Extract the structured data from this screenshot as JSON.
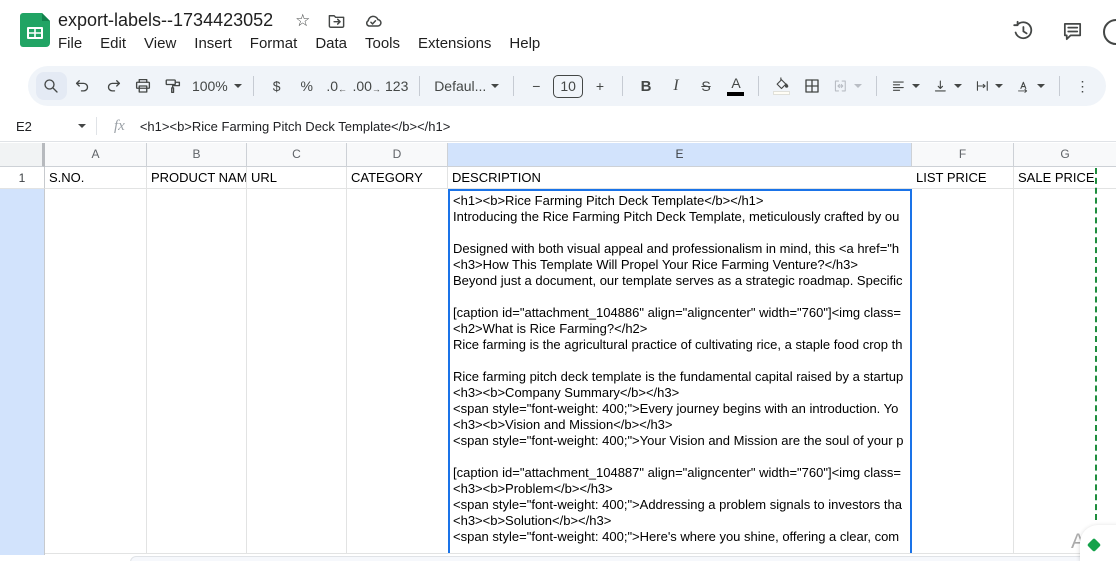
{
  "colors": {
    "logo_green": "#21a464",
    "selection_blue": "#1a73e8",
    "selected_header_bg": "#d2e3fc",
    "dashed_green": "#1e8e3e",
    "toolbar_bg": "#f0f4f9"
  },
  "header": {
    "title": "export-labels--1734423052",
    "menu": [
      "File",
      "Edit",
      "View",
      "Insert",
      "Format",
      "Data",
      "Tools",
      "Extensions",
      "Help"
    ]
  },
  "toolbar": {
    "zoom": "100%",
    "currency": "$",
    "percent": "%",
    "decimal_decrease": ".0",
    "decimal_increase": ".00",
    "number_format": "123",
    "font_family": "Defaul...",
    "minus": "−",
    "font_size": "10",
    "plus": "+",
    "bold": "B",
    "italic": "I",
    "strikethrough": "S",
    "text_color": "A",
    "more": "⋮"
  },
  "formula_bar": {
    "cell_reference": "E2",
    "fx": "fx",
    "formula": "<h1><b>Rice Farming Pitch Deck Template</b></h1>"
  },
  "grid": {
    "columns": [
      "A",
      "B",
      "C",
      "D",
      "E",
      "F",
      "G"
    ],
    "selected_column": "E",
    "row_numbers": [
      "1"
    ],
    "header_row": [
      "S.NO.",
      "PRODUCT NAM",
      "URL",
      "CATEGORY",
      "DESCRIPTION",
      "LIST PRICE",
      "SALE PRICE"
    ],
    "e2_lines": [
      "<h1><b>Rice Farming Pitch Deck Template</b></h1>",
      "Introducing the Rice Farming Pitch Deck Template, meticulously crafted by ou",
      "",
      "Designed with both visual appeal and professionalism in mind, this <a href=\"h",
      "<h3>How This Template Will Propel Your Rice Farming Venture?</h3>",
      "Beyond just a document, our template serves as a strategic roadmap. Specific",
      "",
      "[caption id=\"attachment_104886\" align=\"aligncenter\" width=\"760\"]<img class=",
      "<h2>What is Rice Farming?</h2>",
      "Rice farming is the agricultural practice of cultivating rice, a staple food crop th",
      "",
      "Rice farming pitch deck template is the fundamental capital raised by a startup",
      "<h3><b>Company Summary</b></h3>",
      "<span style=\"font-weight: 400;\">Every journey begins with an introduction. Yo",
      "<h3><b>Vision and Mission</b></h3>",
      "<span style=\"font-weight: 400;\">Your Vision and Mission are the soul of your p",
      "",
      "[caption id=\"attachment_104887\" align=\"aligncenter\" width=\"760\"]<img class=",
      "<h3><b>Problem</b></h3>",
      "<span style=\"font-weight: 400;\">Addressing a problem signals to investors tha",
      "<h3><b>Solution</b></h3>",
      "<span style=\"font-weight: 400;\">Here's where you shine, offering a clear, com"
    ]
  },
  "watermark": {
    "text": "Activ"
  }
}
